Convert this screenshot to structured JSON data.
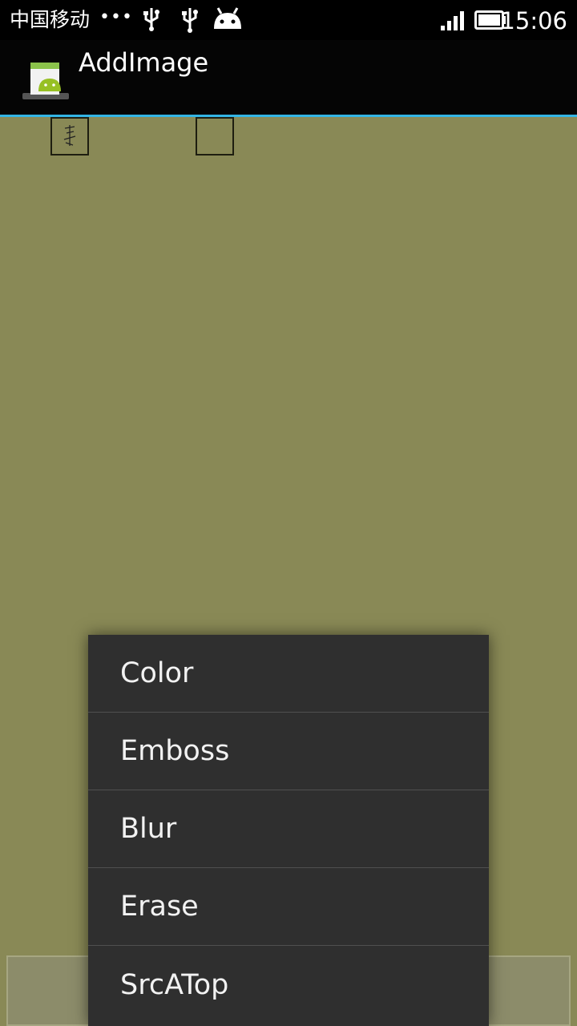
{
  "status_bar": {
    "carrier": "中国移动",
    "time": "15:06"
  },
  "action_bar": {
    "title": "AddImage"
  },
  "menu": {
    "items": [
      {
        "label": "Color"
      },
      {
        "label": "Emboss"
      },
      {
        "label": "Blur"
      },
      {
        "label": "Erase"
      },
      {
        "label": "SrcATop"
      }
    ]
  },
  "colors": {
    "canvas_background": "#898956",
    "menu_background": "#2f2f2f",
    "action_bar_underline": "#33b5e5"
  }
}
